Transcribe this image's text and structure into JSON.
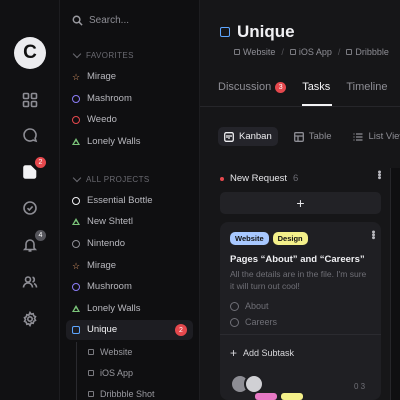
{
  "window": {
    "dot_colors": [
      "#ff5f57",
      "#febc2e",
      "#28c840"
    ]
  },
  "rail": {
    "logo": "C",
    "items": [
      {
        "icon": "grid-icon",
        "badge": null
      },
      {
        "icon": "chat-icon",
        "badge": null
      },
      {
        "icon": "files-icon",
        "badge": "2",
        "active": true
      },
      {
        "icon": "check-circle-icon",
        "badge": null
      },
      {
        "icon": "bell-icon",
        "badge": "4"
      },
      {
        "icon": "users-icon",
        "badge": null
      },
      {
        "icon": "gear-icon",
        "badge": null
      }
    ]
  },
  "sidebar": {
    "search_placeholder": "Search...",
    "favorites_title": "FAVORITES",
    "favorites": [
      {
        "label": "Mirage",
        "icon": "star-icon",
        "color": "#e09a6a"
      },
      {
        "label": "Mashroom",
        "icon": "circle-icon",
        "color": "#8b7cf6"
      },
      {
        "label": "Weedo",
        "icon": "circle-icon",
        "color": "#e5484d"
      },
      {
        "label": "Lonely Walls",
        "icon": "triangle-icon",
        "color": "#7bc47a"
      }
    ],
    "projects_title": "ALL PROJECTS",
    "projects": [
      {
        "label": "Essential Bottle",
        "icon": "circle-icon",
        "color": "#f0f0f3"
      },
      {
        "label": "New Shtetl",
        "icon": "triangle-icon",
        "color": "#7bc47a"
      },
      {
        "label": "Nintendo",
        "icon": "circle-icon",
        "color": "#8e8e95"
      },
      {
        "label": "Mirage",
        "icon": "star-icon",
        "color": "#e09a6a"
      },
      {
        "label": "Mushroom",
        "icon": "circle-icon",
        "color": "#8b7cf6"
      },
      {
        "label": "Lonely Walls",
        "icon": "triangle-icon",
        "color": "#7bc47a"
      }
    ],
    "active_project": {
      "label": "Unique",
      "count": "2"
    },
    "sub_items": [
      "Website",
      "iOS App",
      "Dribbble Shot"
    ]
  },
  "header": {
    "title": "Unique",
    "breadcrumbs": [
      "Website",
      "iOS App",
      "Dribbble"
    ]
  },
  "tabs": [
    {
      "label": "Discussion",
      "badge": "3"
    },
    {
      "label": "Tasks",
      "active": true
    },
    {
      "label": "Timeline"
    }
  ],
  "views": [
    {
      "label": "Kanban",
      "active": true
    },
    {
      "label": "Table"
    },
    {
      "label": "List View"
    }
  ],
  "column": {
    "title": "New Request",
    "count": "6",
    "add_label": "+"
  },
  "card": {
    "tags": [
      {
        "label": "Website",
        "color": "#a8c8ff"
      },
      {
        "label": "Design",
        "color": "#f4f08a"
      }
    ],
    "title": "Pages “About” and “Careers”",
    "description": "All the details are in the file. I'm sure it will turn out cool!",
    "checklist": [
      "About",
      "Careers"
    ],
    "add_subtask": "Add Subtask",
    "meta": "0 3"
  },
  "peek_tag_colors": [
    "#e879c5",
    "#f4f08a"
  ]
}
